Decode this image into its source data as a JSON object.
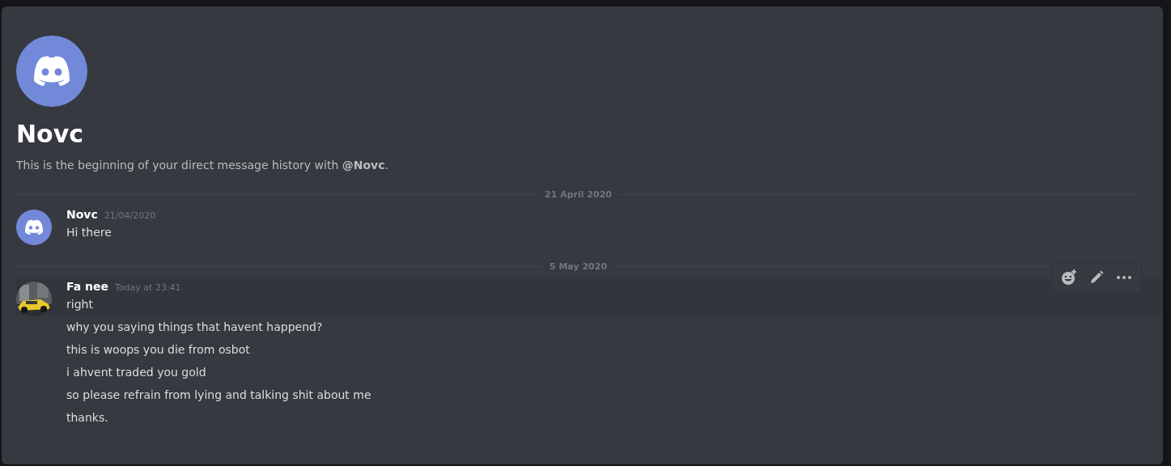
{
  "header": {
    "name": "Novc",
    "intro": "This is the beginning of your direct message history with **@Novc**."
  },
  "groups": [
    {
      "date": "21 April 2020",
      "author": "Novc",
      "kind": "logo",
      "timestamp": "21/04/2020",
      "lines": [
        {
          "text": "Hi there",
          "hovered": false
        }
      ]
    },
    {
      "date": "5 May 2020",
      "author": "Fa nee",
      "kind": "picture",
      "timestamp": "Today at 23:41",
      "lines": [
        {
          "text": "right",
          "hovered": true
        },
        {
          "text": "why you saying things that havent happend?",
          "hovered": false
        },
        {
          "text": "this is woops you die from osbot",
          "hovered": false
        },
        {
          "text": "i ahvent traded you gold",
          "hovered": false
        },
        {
          "text": "so please refrain from lying and talking shit about me",
          "hovered": false
        },
        {
          "text": "thanks.",
          "hovered": false
        }
      ]
    }
  ]
}
